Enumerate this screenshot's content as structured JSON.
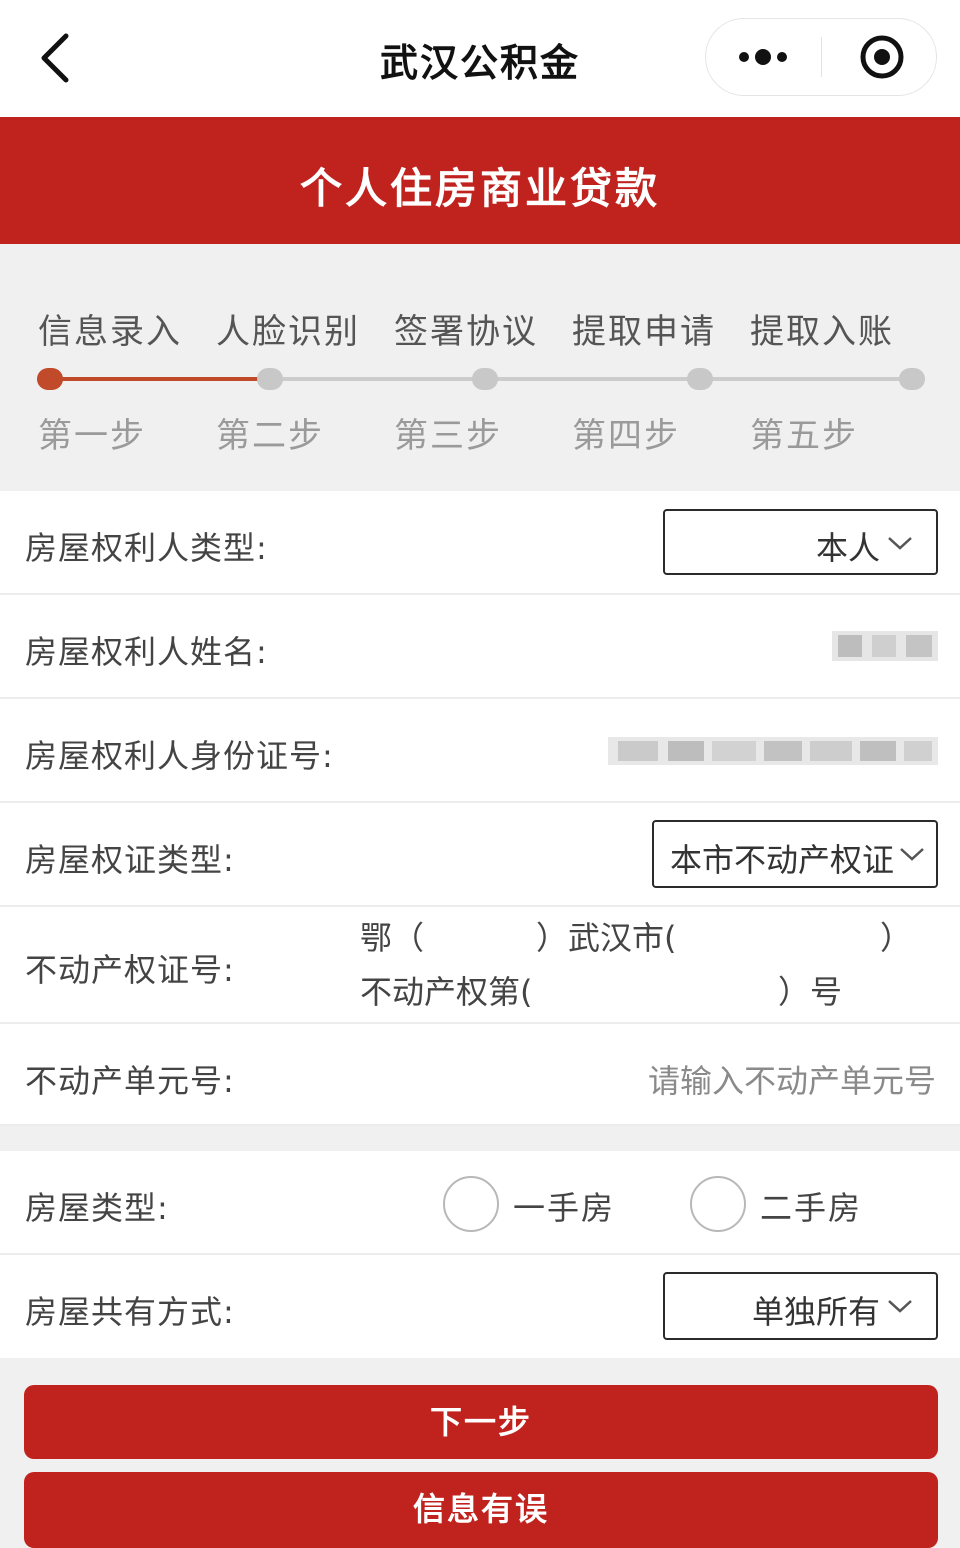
{
  "nav": {
    "title": "武汉公积金",
    "back_icon": "chevron-left-icon",
    "more_icon": "more-dots-icon",
    "close_icon": "target-close-icon"
  },
  "banner": {
    "title": "个人住房商业贷款"
  },
  "colors": {
    "brand_red": "#c0221e",
    "active_step": "#c04a2a",
    "inactive": "#c8c8c8"
  },
  "steps": {
    "items": [
      {
        "label": "信息录入",
        "sub": "第一步",
        "active": true
      },
      {
        "label": "人脸识别",
        "sub": "第二步",
        "active": false
      },
      {
        "label": "签署协议",
        "sub": "第三步",
        "active": false
      },
      {
        "label": "提取申请",
        "sub": "第四步",
        "active": false
      },
      {
        "label": "提取入账",
        "sub": "第五步",
        "active": false
      }
    ]
  },
  "form": {
    "owner_type": {
      "label": "房屋权利人类型:",
      "value": "本人"
    },
    "owner_name": {
      "label": "房屋权利人姓名:"
    },
    "owner_id": {
      "label": "房屋权利人身份证号:"
    },
    "cert_type": {
      "label": "房屋权证类型:",
      "value": "本市不动产权证"
    },
    "cert_no": {
      "label": "不动产权证号:",
      "part1": "鄂（",
      "part2": "）武汉市(",
      "part3": "）",
      "part4": "不动产权第(",
      "part5": "）号"
    },
    "unit_no": {
      "label": "不动产单元号:",
      "placeholder": "请输入不动产单元号"
    },
    "house_type": {
      "label": "房屋类型:",
      "option1": "一手房",
      "option2": "二手房"
    },
    "co_own": {
      "label": "房屋共有方式:",
      "value": "单独所有"
    }
  },
  "buttons": {
    "next": "下一步",
    "error": "信息有误"
  }
}
